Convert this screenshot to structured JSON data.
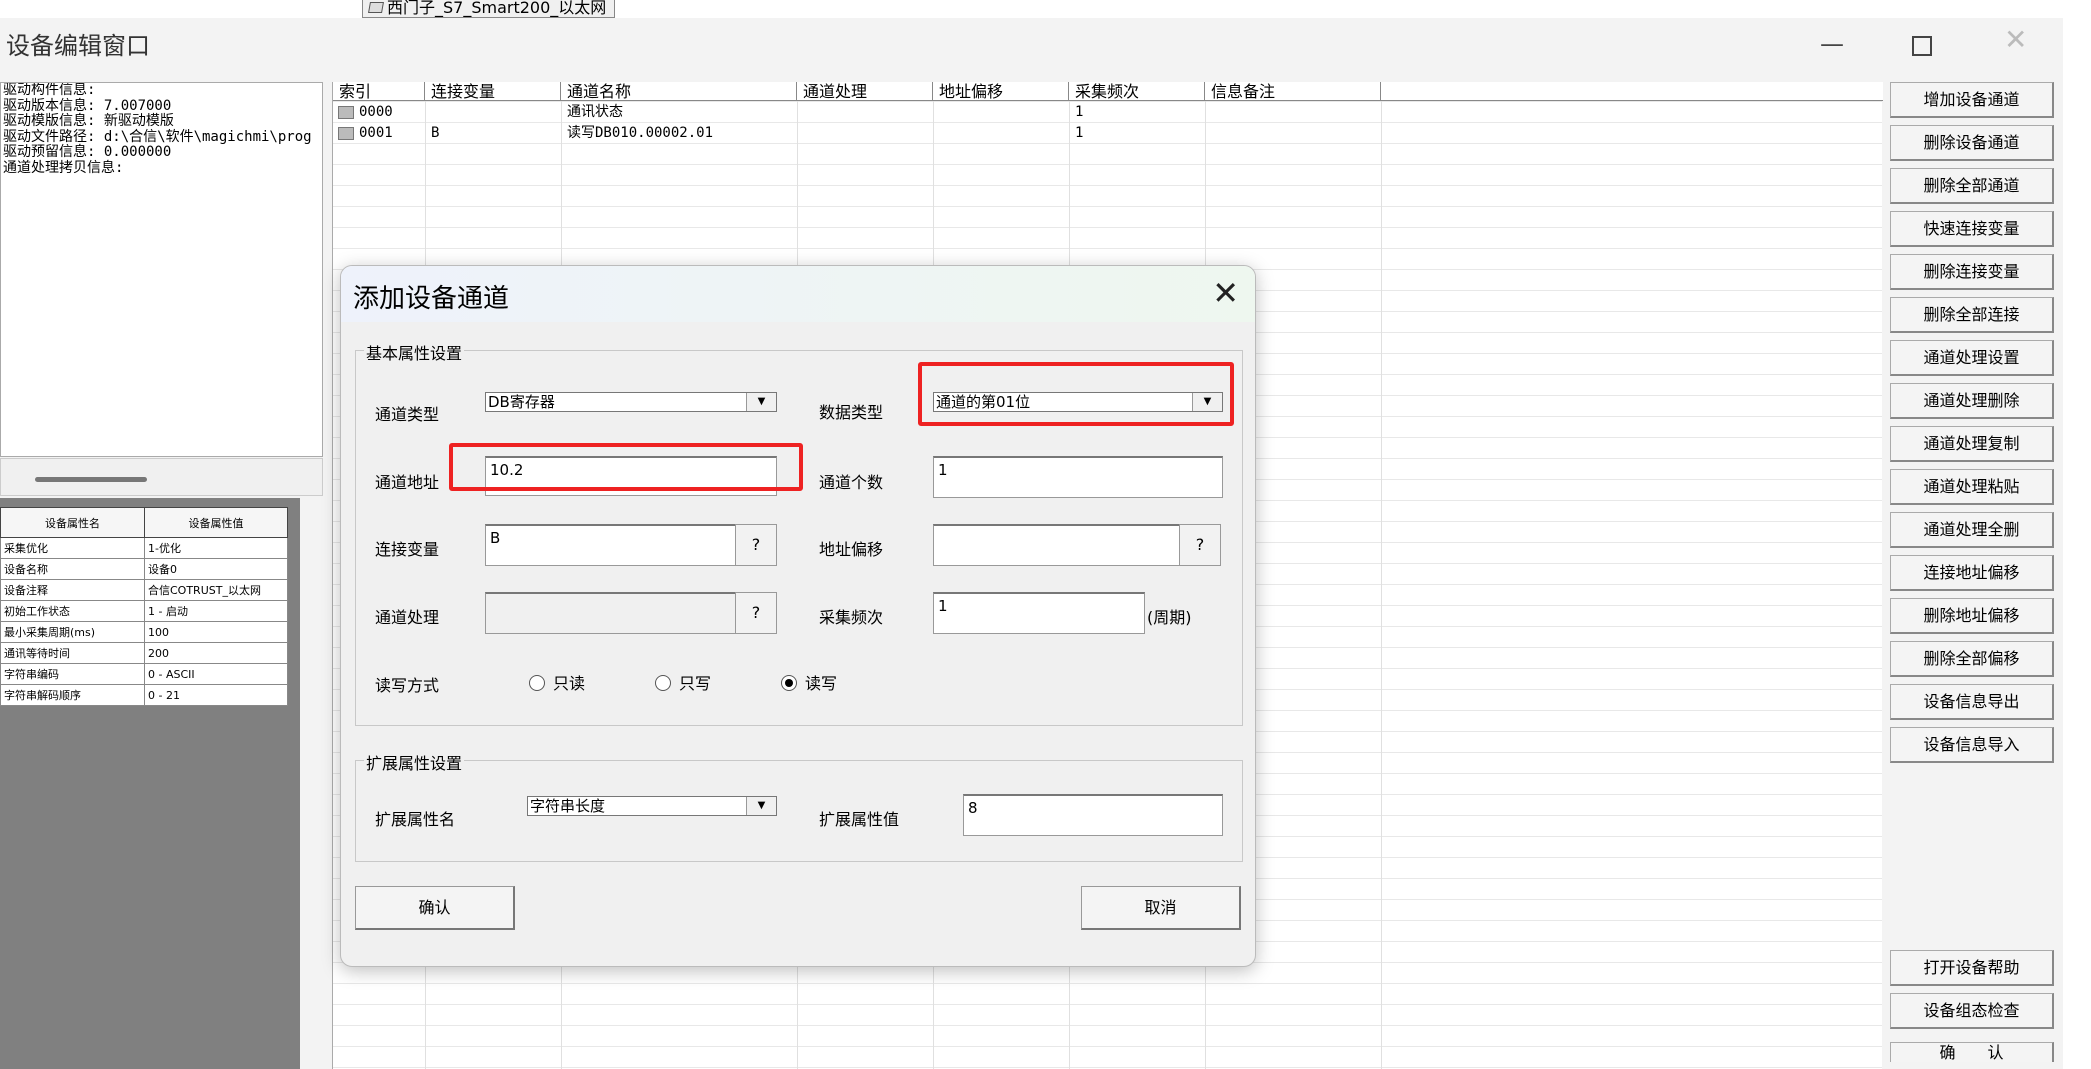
{
  "top_tab": "西门子_S7_Smart200_以太网",
  "window": {
    "title": "设备编辑窗口"
  },
  "info_lines": [
    "驱动构件信息:",
    "驱动版本信息: 7.007000",
    "驱动模版信息: 新驱动模版",
    "驱动文件路径: d:\\合信\\软件\\magichmi\\prog",
    "驱动预留信息: 0.000000",
    "通道处理拷贝信息:"
  ],
  "props": {
    "headers": [
      "设备属性名",
      "设备属性值"
    ],
    "rows": [
      [
        "采集优化",
        "1-优化"
      ],
      [
        "设备名称",
        "设备0"
      ],
      [
        "设备注释",
        "合信COTRUST_以太网"
      ],
      [
        "初始工作状态",
        "1 - 启动"
      ],
      [
        "最小采集周期(ms)",
        "100"
      ],
      [
        "通讯等待时间",
        "200"
      ],
      [
        "字符串编码",
        "0 - ASCII"
      ],
      [
        "字符串解码顺序",
        "0 - 21"
      ]
    ]
  },
  "grid": {
    "headers": [
      "索引",
      "连接变量",
      "通道名称",
      "通道处理",
      "地址偏移",
      "采集频次",
      "信息备注"
    ],
    "rows": [
      {
        "index": "0000",
        "var": "",
        "name": "通讯状态",
        "freq": "1"
      },
      {
        "index": "0001",
        "var": "B",
        "name": "读写DB010.00002.01",
        "freq": "1"
      }
    ]
  },
  "right_buttons": [
    "增加设备通道",
    "删除设备通道",
    "删除全部通道",
    "快速连接变量",
    "删除连接变量",
    "删除全部连接",
    "通道处理设置",
    "通道处理删除",
    "通道处理复制",
    "通道处理粘贴",
    "通道处理全删",
    "连接地址偏移",
    "删除地址偏移",
    "删除全部偏移",
    "设备信息导出",
    "设备信息导入"
  ],
  "bottom_buttons": {
    "help": "打开设备帮助",
    "check": "设备组态检查",
    "ok": "确　　认"
  },
  "dialog": {
    "title": "添加设备通道",
    "basic_group": "基本属性设置",
    "ext_group": "扩展属性设置",
    "channel_type_label": "通道类型",
    "channel_type_value": "DB寄存器",
    "data_type_label": "数据类型",
    "data_type_value": "通道的第01位",
    "address_label": "通道地址",
    "address_value": "10.2",
    "count_label": "通道个数",
    "count_value": "1",
    "var_label": "连接变量",
    "var_value": "B",
    "offset_label": "地址偏移",
    "offset_value": "",
    "proc_label": "通道处理",
    "proc_value": "",
    "freq_label": "采集频次",
    "freq_value": "1",
    "freq_unit": "(周期)",
    "rw_label": "读写方式",
    "rw_options": [
      "只读",
      "只写",
      "读写"
    ],
    "rw_selected": 2,
    "ext_name_label": "扩展属性名",
    "ext_name_value": "字符串长度",
    "ext_value_label": "扩展属性值",
    "ext_value_value": "8",
    "help_glyph": "?",
    "confirm": "确认",
    "cancel": "取消"
  },
  "colors": {
    "highlight": "#e22222",
    "left_gray": "#808080"
  }
}
